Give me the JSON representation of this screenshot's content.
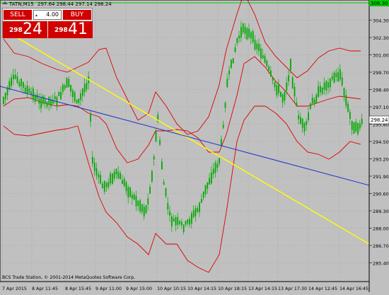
{
  "window": {
    "symbol_label": "TATN,M15",
    "ohlc_text": "297.64 298.44 297.14 298.24",
    "copyright": "BCS Trade Station, © 2001-2014 MetaQuotes Software Corp."
  },
  "one_click": {
    "sell_label": "SELL",
    "buy_label": "BUY",
    "lot_value": "4.00",
    "sell_price_small": "298",
    "sell_price_big": "24",
    "buy_price_small": "298",
    "buy_price_big": "41"
  },
  "price_axis": {
    "labels": [
      "306.30",
      "304.30",
      "302.30",
      "301.00",
      "299.70",
      "298.40",
      "297.10",
      "295.80",
      "294.50",
      "293.20",
      "291.90",
      "290.60",
      "289.30",
      "288.00",
      "286.70",
      "285.40"
    ],
    "current_price": "298.24",
    "top_marker": "306.30"
  },
  "time_axis": {
    "labels": [
      "7 Apr 2015",
      "8 Apr 11:45",
      "8 Apr 15:45",
      "9 Apr 11:00",
      "9 Apr 15:00",
      "10 Apr 10:15",
      "10 Apr 14:15",
      "10 Apr 18:15",
      "13 Apr 14:15",
      "13 Apr 17:30",
      "14 Apr 12:45",
      "14 Apr 16:45"
    ]
  },
  "colors": {
    "background": "#c0c0c0",
    "grid": "#a8a8a8",
    "candle": "#00aa00",
    "bollinger": "#dd0000",
    "trend_yellow": "#ffff00",
    "trend_blue": "#2233cc",
    "sell_buy": "#d10000",
    "top_line": "#00cc00"
  }
}
